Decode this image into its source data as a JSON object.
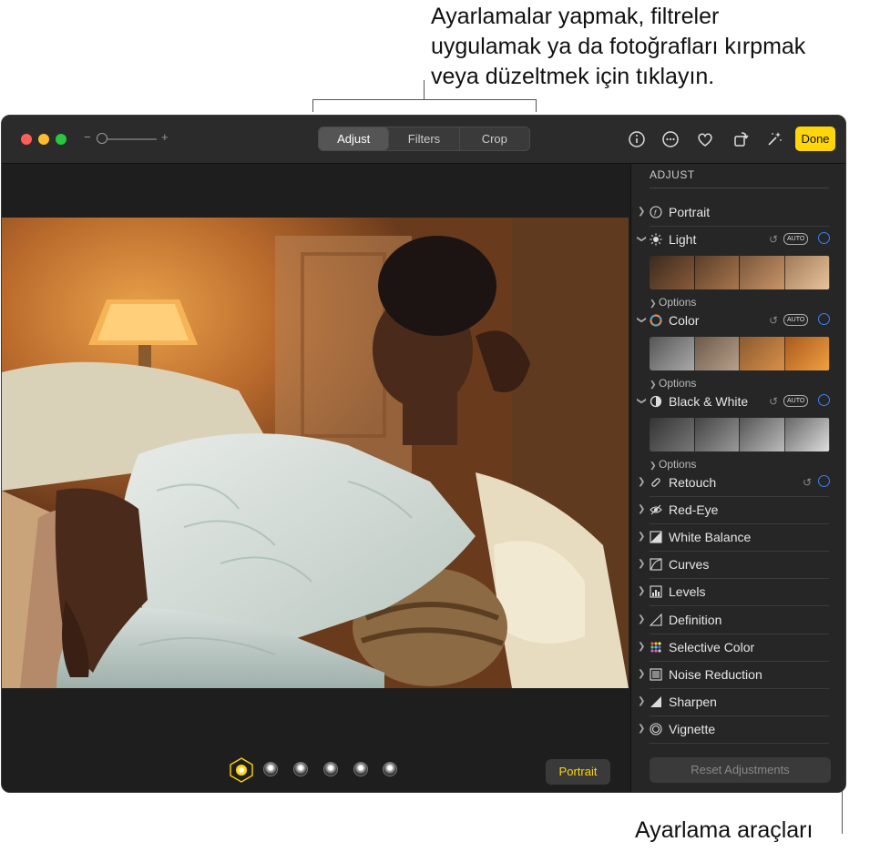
{
  "annotations": {
    "top_callout": [
      "Ayarlamalar yapmak, filtreler",
      "uygulamak ya da fotoğrafları kırpmak",
      "veya düzeltmek için tıklayın."
    ],
    "bottom_callout": "Ayarlama araçları"
  },
  "toolbar": {
    "zoom_minus": "−",
    "zoom_plus": "+",
    "zoom_level": 0.1,
    "tabs": [
      {
        "label": "Adjust",
        "active": true
      },
      {
        "label": "Filters",
        "active": false
      },
      {
        "label": "Crop",
        "active": false
      }
    ],
    "icons": [
      "info-icon",
      "more-icon",
      "heart-icon",
      "rotate-icon",
      "magic-wand-icon"
    ],
    "done_label": "Done"
  },
  "viewer": {
    "portrait_label": "Portrait",
    "lighting_icons": [
      "natural-light-icon",
      "studio-light-icon",
      "contour-light-icon",
      "stage-light-icon",
      "stage-light-mono-icon",
      "high-key-light-icon"
    ]
  },
  "sidebar": {
    "title": "ADJUST",
    "portrait": "Portrait",
    "light": {
      "label": "Light",
      "auto": "AUTO",
      "options": "Options"
    },
    "color": {
      "label": "Color",
      "auto": "AUTO",
      "options": "Options"
    },
    "bw": {
      "label": "Black & White",
      "auto": "AUTO",
      "options": "Options"
    },
    "retouch": "Retouch",
    "red_eye": "Red-Eye",
    "white_balance": "White Balance",
    "curves": "Curves",
    "levels": "Levels",
    "definition": "Definition",
    "selective_color": "Selective Color",
    "noise_reduction": "Noise Reduction",
    "sharpen": "Sharpen",
    "vignette": "Vignette",
    "reset_label": "Reset Adjustments"
  },
  "colors": {
    "accent_yellow": "#ffd60a",
    "accent_blue": "#3b82f6",
    "traffic_red": "#ff5f57",
    "traffic_yellow": "#febc2e",
    "traffic_green": "#28c840"
  }
}
